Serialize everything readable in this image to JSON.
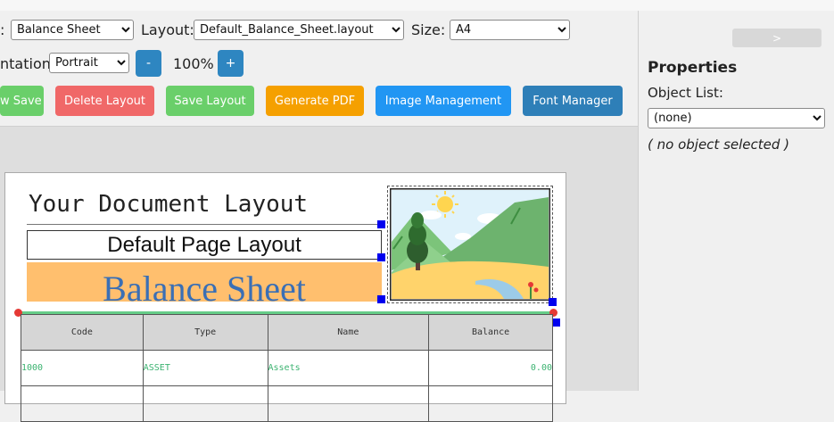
{
  "toolbar": {
    "report_label": ":",
    "report_value": "Balance Sheet",
    "layout_label": "Layout:",
    "layout_value": "Default_Balance_Sheet.layout",
    "size_label": "Size:",
    "size_value": "A4",
    "orientation_label": "ntation:",
    "orientation_value": "Portrait",
    "zoom_out": "-",
    "zoom_level": "100%",
    "zoom_in": "+",
    "buttons": {
      "new_save": "w Save",
      "delete_layout": "Delete Layout",
      "save_layout": "Save Layout",
      "generate_pdf": "Generate PDF",
      "image_management": "Image Management",
      "font_manager": "Font Manager"
    }
  },
  "canvas": {
    "doc_title": "Your Document Layout",
    "page_layout_text": "Default Page Layout",
    "report_title": "Balance Sheet",
    "table": {
      "headers": [
        "Code",
        "Type",
        "Name",
        "Balance"
      ],
      "rows": [
        [
          "1000",
          "ASSET",
          "Assets",
          "0.00"
        ]
      ]
    }
  },
  "sidebar": {
    "collapse": ">",
    "title": "Properties",
    "object_list_label": "Object List:",
    "object_list_value": "(none)",
    "no_selection": "( no object selected )"
  },
  "colors": {
    "green_button": "#6acf6a",
    "red_button": "#f06868",
    "orange_button": "#f5a000",
    "blue_button": "#2196f3",
    "dark_blue_button": "#2e7fb8",
    "banner_fill": "#ffbf6e",
    "title_blue": "#3a6fb5",
    "cell_text": "#3cb371",
    "handle": "#0000ee"
  }
}
